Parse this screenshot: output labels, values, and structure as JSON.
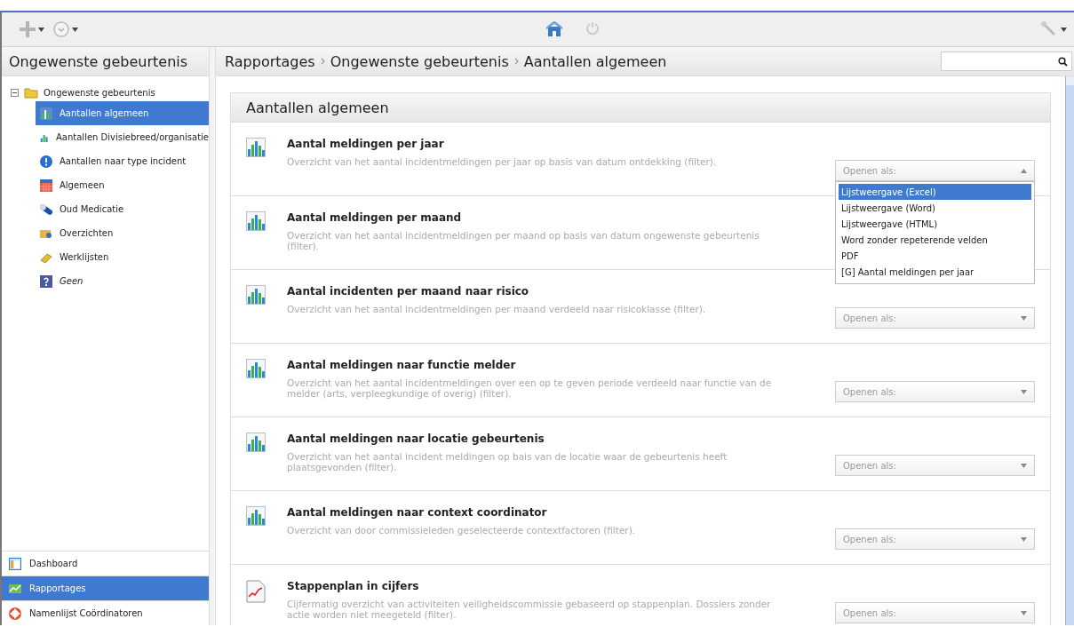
{
  "sidebar": {
    "title": "Ongewenste gebeurtenis",
    "tree": [
      {
        "label": "Ongewenste gebeurtenis",
        "expanded": true,
        "children": [
          {
            "label": "Aantallen algemeen",
            "selected": true
          },
          {
            "label": "Aantallen Divisiebreed/organisatie",
            "selected": false
          },
          {
            "label": "Aantallen naar type incident",
            "selected": false
          },
          {
            "label": "Algemeen",
            "selected": false
          },
          {
            "label": "Oud Medicatie",
            "selected": false
          },
          {
            "label": "Overzichten",
            "selected": false
          },
          {
            "label": "Werklijsten",
            "selected": false
          },
          {
            "label": "Geen",
            "selected": false,
            "empty": true
          }
        ]
      }
    ],
    "nav": [
      {
        "label": "Dashboard",
        "selected": false
      },
      {
        "label": "Rapportages",
        "selected": true
      },
      {
        "label": "Namenlijst Coördinatoren",
        "selected": false
      }
    ]
  },
  "breadcrumb": [
    "Rapportages",
    "Ongewenste gebeurtenis",
    "Aantallen algemeen"
  ],
  "section": {
    "title": "Aantallen algemeen",
    "reports": [
      {
        "kind": "bars",
        "title": "Aantal meldingen per jaar",
        "description": "Overzicht van het aantal incidentmeldingen per jaar op basis van datum ontdekking (filter).",
        "dropdown": {
          "placeholder": "Openen als:",
          "expanded": true,
          "options": [
            {
              "label": "Lijstweergave (Excel)",
              "selected": true
            },
            {
              "label": "Lijstweergave (Word)",
              "selected": false
            },
            {
              "label": "Lijstweergave (HTML)",
              "selected": false
            },
            {
              "label": "Word zonder repeterende velden",
              "selected": false
            },
            {
              "label": "PDF",
              "selected": false
            },
            {
              "label": "[G] Aantal meldingen per jaar",
              "selected": false
            }
          ]
        }
      },
      {
        "kind": "bars",
        "title": "Aantal meldingen per maand",
        "description": "Overzicht van het aantal incidentmeldingen per maand op basis van datum ongewenste gebeurtenis (filter)."
      },
      {
        "kind": "bars",
        "title": "Aantal incidenten per maand naar risico",
        "description": "Overzicht van het aantal incidentmeldingen per maand verdeeld naar risicoklasse (filter).",
        "dropdown": {
          "placeholder": "Openen als:",
          "expanded": false
        }
      },
      {
        "kind": "bars",
        "title": "Aantal meldingen naar functie melder",
        "description": "Overzicht van het aantal incidentmeldingen over een op te geven periode verdeeld naar functie van de melder (arts, verpleegkundige of overig) (filter).",
        "dropdown": {
          "placeholder": "Openen als:",
          "expanded": false
        }
      },
      {
        "kind": "bars",
        "title": "Aantal meldingen naar locatie gebeurtenis",
        "description": "Overzicht van het aantal incident meldingen op bais van de locatie waar de gebeurtenis heeft plaatsgevonden (filter).",
        "dropdown": {
          "placeholder": "Openen als:",
          "expanded": false
        }
      },
      {
        "kind": "bars",
        "title": "Aantal meldingen naar context coordinator",
        "description": "Overzicht van door commissieleden geselecteerde contextfactoren (filter).",
        "dropdown": {
          "placeholder": "Openen als:",
          "expanded": false
        }
      },
      {
        "kind": "line",
        "title": "Stappenplan in cijfers",
        "description": "Cijfermatig overzicht van activiteiten veiligheidscommissie gebaseerd op stappenplan. Dossiers zonder actie worden niet meegeteld (filter).",
        "dropdown": {
          "placeholder": "Openen als:",
          "expanded": false
        }
      }
    ]
  }
}
